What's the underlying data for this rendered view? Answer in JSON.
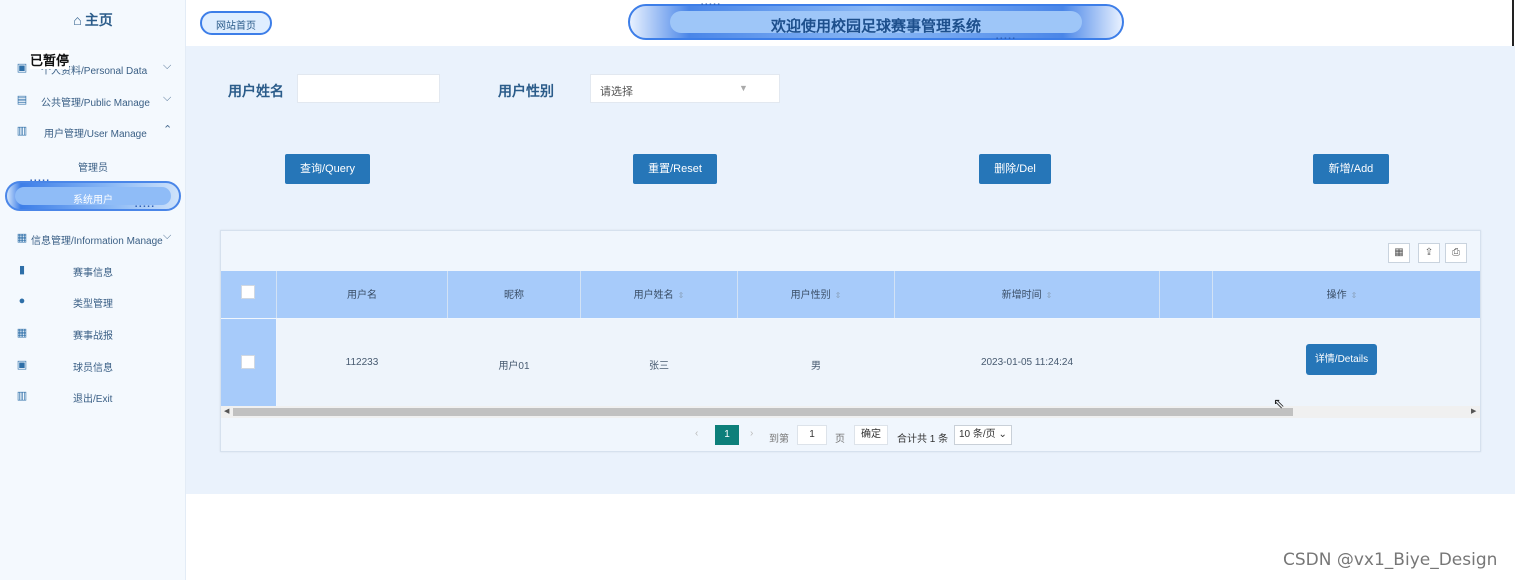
{
  "sidebar": {
    "home_label": "主页",
    "overlay_text": "已暂停",
    "items": [
      {
        "label": "个人资料/Personal Data",
        "icon": "id-card-icon"
      },
      {
        "label": "公共管理/Public Manage",
        "icon": "clipboard-icon"
      },
      {
        "label": "用户管理/User Manage",
        "icon": "building-icon"
      },
      {
        "label": "信息管理/Information Manage",
        "icon": "chart-icon"
      }
    ],
    "user_sub": [
      "管理员",
      "系统用户"
    ],
    "info_sub": [
      {
        "label": "赛事信息",
        "icon": "bookmark-icon"
      },
      {
        "label": "类型管理",
        "icon": "user-icon"
      },
      {
        "label": "赛事战报",
        "icon": "calendar-icon"
      },
      {
        "label": "球员信息",
        "icon": "calendar-check-icon"
      },
      {
        "label": "退出/Exit",
        "icon": "book-icon"
      }
    ]
  },
  "header": {
    "home_button": "网站首页",
    "title": "欢迎使用校园足球赛事管理系统"
  },
  "search": {
    "name_label": "用户姓名",
    "name_value": "",
    "gender_label": "用户性别",
    "gender_placeholder": "请选择"
  },
  "actions": {
    "query": "查询/Query",
    "reset": "重置/Reset",
    "delete": "删除/Del",
    "add": "新增/Add"
  },
  "table": {
    "columns": [
      "用户名",
      "昵称",
      "用户姓名",
      "用户性别",
      "新增时间",
      "操作"
    ],
    "rows": [
      {
        "username": "112233",
        "nickname": "用户01",
        "realname": "张三",
        "gender": "男",
        "created": "2023-01-05 11:24:24",
        "action": "详情/Details"
      }
    ]
  },
  "pagination": {
    "current_page": "1",
    "goto_label": "到第",
    "goto_value": "1",
    "page_unit": "页",
    "confirm": "确定",
    "total": "合计共 1 条",
    "page_size": "10 条/页"
  },
  "watermark": "CSDN @vx1_Biye_Design"
}
